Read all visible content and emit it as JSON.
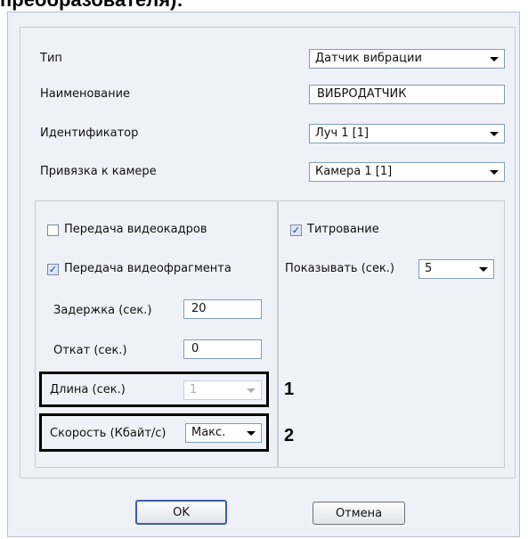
{
  "top_cut_text": "преобразователя):",
  "fields": {
    "type": {
      "label": "Тип",
      "value": "Датчик вибрации"
    },
    "name": {
      "label": "Наименование",
      "value": "ВИБРОДАТЧИК"
    },
    "identifier": {
      "label": "Идентификатор",
      "value": "Луч 1 [1]"
    },
    "camera_binding": {
      "label": "Привязка к камере",
      "value": "Камера 1 [1]"
    }
  },
  "left_group": {
    "frames": {
      "label": "Передача видеокадров",
      "checked": false
    },
    "fragment": {
      "label": "Передача видеофрагмента",
      "checked": true
    },
    "delay": {
      "label": "Задержка (сек.)",
      "value": "20"
    },
    "rollback": {
      "label": "Откат (сек.)",
      "value": "0"
    },
    "length": {
      "label": "Длина (сек.)",
      "value": "1",
      "disabled": true
    },
    "speed": {
      "label": "Скорость (Кбайт/с)",
      "value": "Макс."
    }
  },
  "right_group": {
    "titling": {
      "label": "Титрование",
      "checked": true
    },
    "show": {
      "label": "Показывать (сек.)",
      "value": "5"
    }
  },
  "markers": {
    "one": "1",
    "two": "2"
  },
  "buttons": {
    "ok": "OK",
    "cancel": "Отмена"
  },
  "colors": {
    "panel_bg": "#eff1f8",
    "default_button_border": "#3b5ea8",
    "checkbox_mark": "#1a3f8f"
  }
}
